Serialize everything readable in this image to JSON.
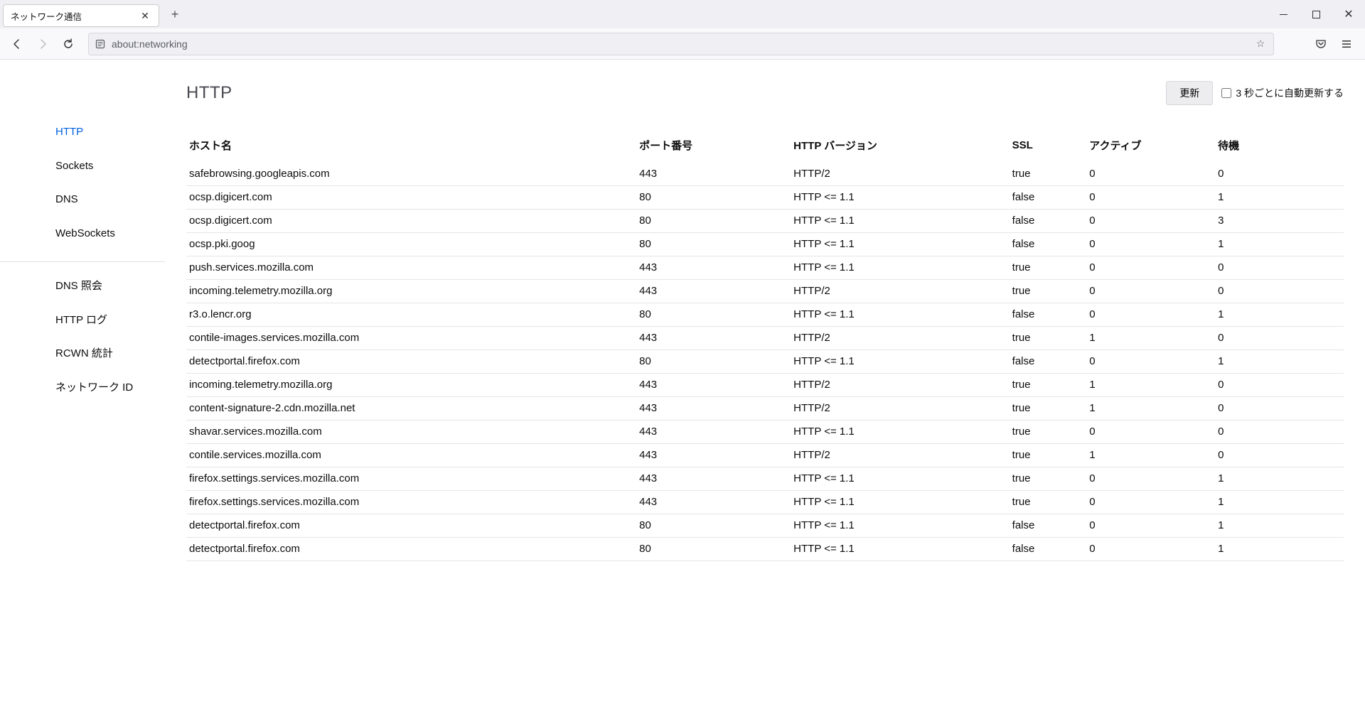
{
  "tab": {
    "title": "ネットワーク通信"
  },
  "url": "about:networking",
  "sidebar": {
    "group1": [
      {
        "label": "HTTP",
        "active": true
      },
      {
        "label": "Sockets"
      },
      {
        "label": "DNS"
      },
      {
        "label": "WebSockets"
      }
    ],
    "group2": [
      {
        "label": "DNS 照会"
      },
      {
        "label": "HTTP ログ"
      },
      {
        "label": "RCWN 統計"
      },
      {
        "label": "ネットワーク ID"
      }
    ]
  },
  "page": {
    "title": "HTTP",
    "refresh": "更新",
    "auto_refresh": "3 秒ごとに自動更新する"
  },
  "columns": {
    "host": "ホスト名",
    "port": "ポート番号",
    "version": "HTTP バージョン",
    "ssl": "SSL",
    "active": "アクティブ",
    "idle": "待機"
  },
  "rows": [
    {
      "host": "safebrowsing.googleapis.com",
      "port": "443",
      "version": "HTTP/2",
      "ssl": "true",
      "active": "0",
      "idle": "0"
    },
    {
      "host": "ocsp.digicert.com",
      "port": "80",
      "version": "HTTP <= 1.1",
      "ssl": "false",
      "active": "0",
      "idle": "1"
    },
    {
      "host": "ocsp.digicert.com",
      "port": "80",
      "version": "HTTP <= 1.1",
      "ssl": "false",
      "active": "0",
      "idle": "3"
    },
    {
      "host": "ocsp.pki.goog",
      "port": "80",
      "version": "HTTP <= 1.1",
      "ssl": "false",
      "active": "0",
      "idle": "1"
    },
    {
      "host": "push.services.mozilla.com",
      "port": "443",
      "version": "HTTP <= 1.1",
      "ssl": "true",
      "active": "0",
      "idle": "0"
    },
    {
      "host": "incoming.telemetry.mozilla.org",
      "port": "443",
      "version": "HTTP/2",
      "ssl": "true",
      "active": "0",
      "idle": "0"
    },
    {
      "host": "r3.o.lencr.org",
      "port": "80",
      "version": "HTTP <= 1.1",
      "ssl": "false",
      "active": "0",
      "idle": "1"
    },
    {
      "host": "contile-images.services.mozilla.com",
      "port": "443",
      "version": "HTTP/2",
      "ssl": "true",
      "active": "1",
      "idle": "0"
    },
    {
      "host": "detectportal.firefox.com",
      "port": "80",
      "version": "HTTP <= 1.1",
      "ssl": "false",
      "active": "0",
      "idle": "1"
    },
    {
      "host": "incoming.telemetry.mozilla.org",
      "port": "443",
      "version": "HTTP/2",
      "ssl": "true",
      "active": "1",
      "idle": "0"
    },
    {
      "host": "content-signature-2.cdn.mozilla.net",
      "port": "443",
      "version": "HTTP/2",
      "ssl": "true",
      "active": "1",
      "idle": "0"
    },
    {
      "host": "shavar.services.mozilla.com",
      "port": "443",
      "version": "HTTP <= 1.1",
      "ssl": "true",
      "active": "0",
      "idle": "0"
    },
    {
      "host": "contile.services.mozilla.com",
      "port": "443",
      "version": "HTTP/2",
      "ssl": "true",
      "active": "1",
      "idle": "0"
    },
    {
      "host": "firefox.settings.services.mozilla.com",
      "port": "443",
      "version": "HTTP <= 1.1",
      "ssl": "true",
      "active": "0",
      "idle": "1"
    },
    {
      "host": "firefox.settings.services.mozilla.com",
      "port": "443",
      "version": "HTTP <= 1.1",
      "ssl": "true",
      "active": "0",
      "idle": "1"
    },
    {
      "host": "detectportal.firefox.com",
      "port": "80",
      "version": "HTTP <= 1.1",
      "ssl": "false",
      "active": "0",
      "idle": "1"
    },
    {
      "host": "detectportal.firefox.com",
      "port": "80",
      "version": "HTTP <= 1.1",
      "ssl": "false",
      "active": "0",
      "idle": "1"
    }
  ]
}
